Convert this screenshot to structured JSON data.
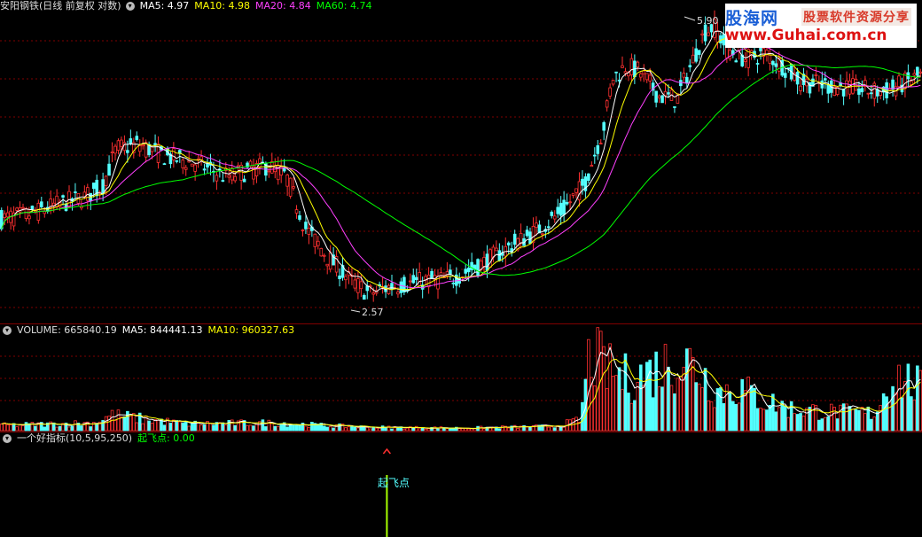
{
  "price_panel": {
    "title": "安阳钢铁(日线 前复权 对数)",
    "ma5": "MA5: 4.97",
    "ma10": "MA10: 4.98",
    "ma20": "MA20: 4.84",
    "ma60": "MA60: 4.74",
    "high_label": "5.90",
    "low_label": "2.57",
    "colors": {
      "ma5": "#ffffff",
      "ma10": "#ffff00",
      "ma20": "#ff40ff",
      "ma60": "#00ff00",
      "up": "#ff3030",
      "down": "#54ffff",
      "grid": "#800000",
      "border": "#800000"
    }
  },
  "volume_panel": {
    "title": "VOLUME: 665840.19",
    "ma5": "MA5: 844441.13",
    "ma10": "MA10: 960327.63"
  },
  "indicator_panel": {
    "title": "一个好指标(10,5,95,250)",
    "value": "起飞点: 0.00",
    "signal_label": "起飞点"
  },
  "watermark": {
    "line1": "股海网",
    "line2": "股票软件资源分享",
    "line3": "www.Guhai.com.cn"
  },
  "chart_data": [
    {
      "type": "line",
      "name": "price",
      "title": "安阳钢铁(日线 前复权 对数)",
      "ylim": [
        2.4,
        6.1
      ],
      "y_scale": "log",
      "grid": true,
      "high": 5.9,
      "low": 2.57,
      "price_path": [
        [
          0,
          3.28
        ],
        [
          0.03,
          3.32
        ],
        [
          0.06,
          3.42
        ],
        [
          0.09,
          3.5
        ],
        [
          0.11,
          3.62
        ],
        [
          0.125,
          4.05
        ],
        [
          0.15,
          4.1
        ],
        [
          0.18,
          3.95
        ],
        [
          0.21,
          3.88
        ],
        [
          0.245,
          3.72
        ],
        [
          0.265,
          3.78
        ],
        [
          0.29,
          3.85
        ],
        [
          0.31,
          3.72
        ],
        [
          0.33,
          3.2
        ],
        [
          0.355,
          2.92
        ],
        [
          0.38,
          2.72
        ],
        [
          0.4,
          2.62
        ],
        [
          0.425,
          2.68
        ],
        [
          0.46,
          2.72
        ],
        [
          0.49,
          2.74
        ],
        [
          0.52,
          2.85
        ],
        [
          0.55,
          3.0
        ],
        [
          0.58,
          3.15
        ],
        [
          0.61,
          3.35
        ],
        [
          0.635,
          3.65
        ],
        [
          0.655,
          4.3
        ],
        [
          0.665,
          5.0
        ],
        [
          0.68,
          5.2
        ],
        [
          0.695,
          5.1
        ],
        [
          0.715,
          4.75
        ],
        [
          0.735,
          4.7
        ],
        [
          0.75,
          5.2
        ],
        [
          0.765,
          5.75
        ],
        [
          0.775,
          5.85
        ],
        [
          0.79,
          5.45
        ],
        [
          0.81,
          5.3
        ],
        [
          0.83,
          5.4
        ],
        [
          0.85,
          5.2
        ],
        [
          0.87,
          4.95
        ],
        [
          0.9,
          4.9
        ],
        [
          0.93,
          4.85
        ],
        [
          0.96,
          4.8
        ],
        [
          0.985,
          4.95
        ],
        [
          1.0,
          5.05
        ]
      ],
      "series": [
        {
          "name": "MA5",
          "value": 4.97
        },
        {
          "name": "MA10",
          "value": 4.98
        },
        {
          "name": "MA20",
          "value": 4.84
        },
        {
          "name": "MA60",
          "value": 4.74
        }
      ]
    },
    {
      "type": "bar",
      "name": "volume",
      "title": "VOLUME",
      "latest": 665840.19,
      "ma5": 844441.13,
      "ma10": 960327.63,
      "ylim": [
        0,
        1000
      ],
      "volume_path": [
        [
          0,
          60
        ],
        [
          0.1,
          90
        ],
        [
          0.12,
          180
        ],
        [
          0.15,
          140
        ],
        [
          0.2,
          80
        ],
        [
          0.3,
          90
        ],
        [
          0.35,
          60
        ],
        [
          0.4,
          40
        ],
        [
          0.5,
          30
        ],
        [
          0.55,
          40
        ],
        [
          0.6,
          50
        ],
        [
          0.63,
          120
        ],
        [
          0.64,
          900
        ],
        [
          0.66,
          700
        ],
        [
          0.68,
          600
        ],
        [
          0.7,
          650
        ],
        [
          0.72,
          750
        ],
        [
          0.74,
          850
        ],
        [
          0.76,
          700
        ],
        [
          0.78,
          450
        ],
        [
          0.8,
          500
        ],
        [
          0.83,
          350
        ],
        [
          0.86,
          250
        ],
        [
          0.9,
          220
        ],
        [
          0.95,
          200
        ],
        [
          0.97,
          650
        ],
        [
          1.0,
          500
        ]
      ]
    },
    {
      "type": "line",
      "name": "indicator",
      "title": "一个好指标(10,5,95,250)",
      "value": 0.0,
      "signal_position": 0.41,
      "signal_label": "起飞点"
    }
  ]
}
